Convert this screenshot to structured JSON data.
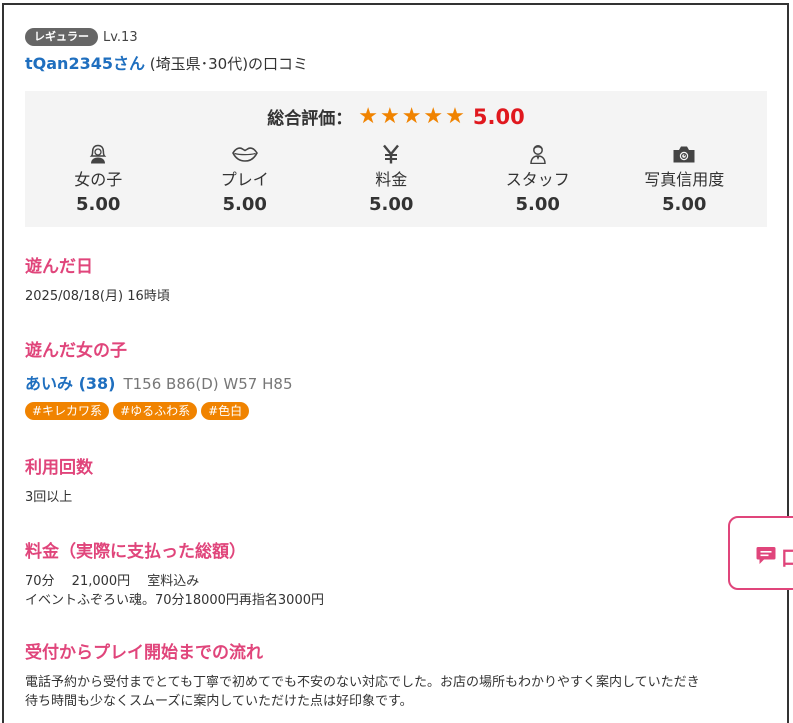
{
  "reviewer": {
    "rank_badge": "レギュラー",
    "level": "Lv.13",
    "name": "tQan2345さん",
    "meta": "(埼玉県･30代)の口コミ"
  },
  "rating": {
    "overall_label": "総合評価：",
    "stars": "★★★★★",
    "overall_score": "5.00",
    "categories": [
      {
        "icon": "girl-icon",
        "label": "女の子",
        "score": "5.00"
      },
      {
        "icon": "lips-icon",
        "label": "プレイ",
        "score": "5.00"
      },
      {
        "icon": "yen-icon",
        "label": "料金",
        "score": "5.00"
      },
      {
        "icon": "staff-icon",
        "label": "スタッフ",
        "score": "5.00"
      },
      {
        "icon": "camera-icon",
        "label": "写真信用度",
        "score": "5.00"
      }
    ]
  },
  "sections": {
    "visit_date": {
      "title": "遊んだ日",
      "text": "2025/08/18(月) 16時頃"
    },
    "girl": {
      "title": "遊んだ女の子",
      "name": "あいみ (38)",
      "stats": "T156 B86(D) W57 H85",
      "tags": [
        "#キレカワ系",
        "#ゆるふわ系",
        "#色白"
      ]
    },
    "usage": {
      "title": "利用回数",
      "text": "3回以上"
    },
    "price": {
      "title": "料金（実際に支払った総額）",
      "line1": "70分　 21,000円　 室料込み",
      "line2": "イベントふぞろい魂。70分18000円再指名3000円"
    },
    "flow": {
      "title": "受付からプレイ開始までの流れ",
      "line1": "電話予約から受付までとても丁寧で初めてでも不安のない対応でした。お店の場所もわかりやすく案内していただき",
      "line2": "待ち時間も少なくスムーズに案内していただけた点は好印象です。"
    }
  },
  "float_button": {
    "label": "口",
    "icon": "comment-icon"
  },
  "colors": {
    "accent_pink": "#e0457b",
    "link_blue": "#1f6fbf",
    "star_orange": "#f08300",
    "score_red": "#e0181e"
  }
}
